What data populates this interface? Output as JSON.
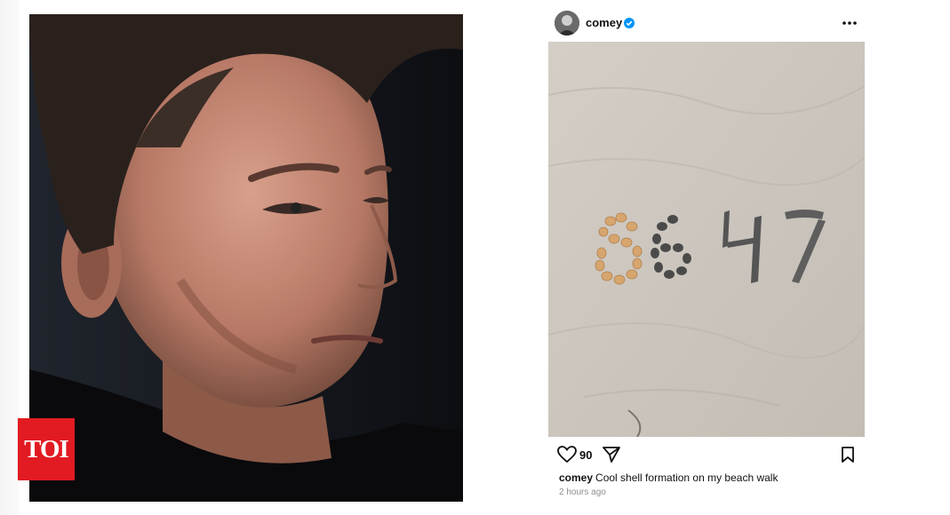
{
  "brand": {
    "logo_text": "TOI",
    "logo_color": "#e21b22"
  },
  "post": {
    "username": "comey",
    "verified_icon": "verified-badge-icon",
    "more_icon": "more-options-icon",
    "likes": "90",
    "caption_user": "comey",
    "caption_text": "Cool shell formation on my beach walk",
    "timestamp": "2 hours ago",
    "sand_text": "8647",
    "icons": [
      "heart-icon",
      "share-icon",
      "bookmark-icon"
    ]
  },
  "colors": {
    "verified": "#0095f6",
    "sand": "#cfc9c0",
    "shell": "#d7a56e",
    "stone": "#4a4a4a"
  }
}
